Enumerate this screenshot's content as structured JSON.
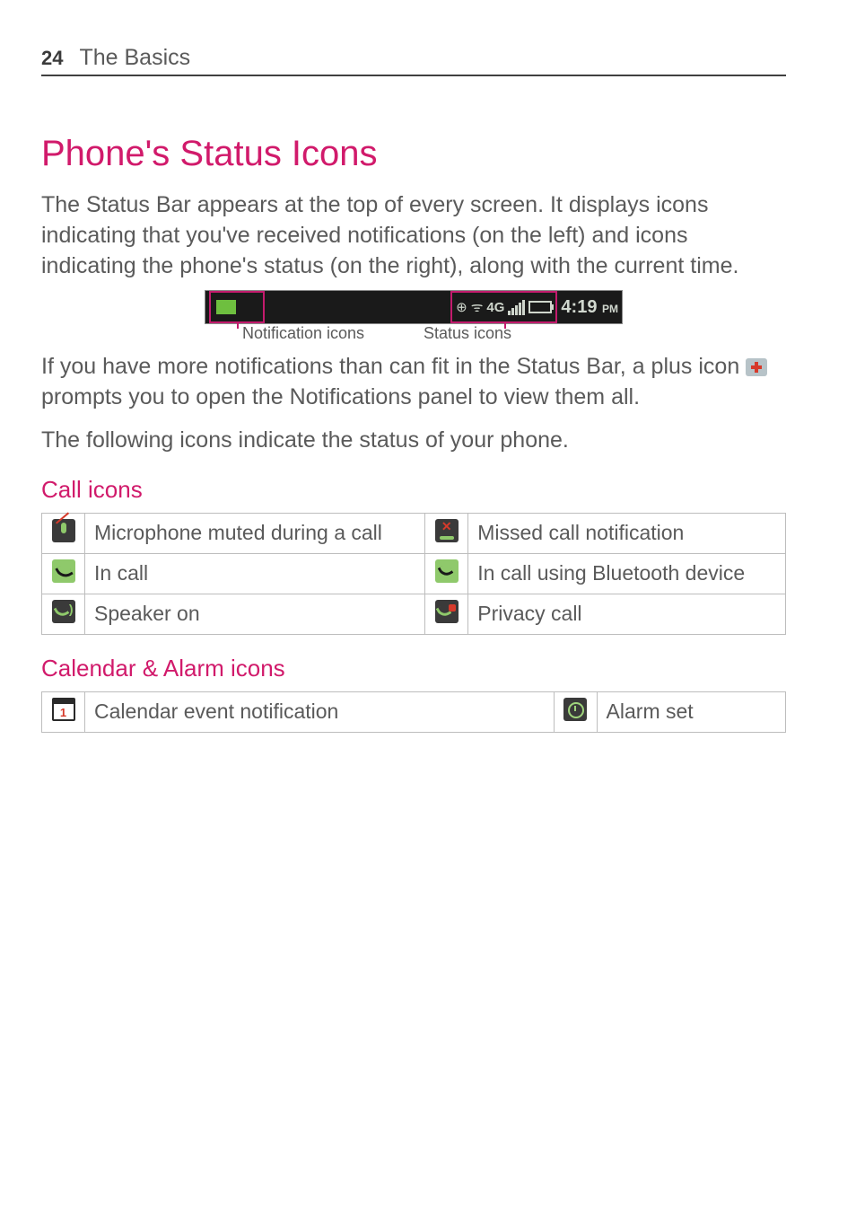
{
  "header": {
    "page_number": "24",
    "section": "The Basics"
  },
  "title": "Phone's Status Icons",
  "intro": "The Status Bar appears at the top of every screen. It displays icons indicating that you've received notifications (on the left) and icons indicating the phone's status (on the right), along with the current time.",
  "status_bar": {
    "time": "4:19",
    "time_suffix": "PM",
    "data_label": "4G",
    "caption_left": "Notification icons",
    "caption_right": "Status icons"
  },
  "plus_para_a": "If you have more notifications than can fit in the Status Bar, a plus icon ",
  "plus_para_b": " prompts you to open the Notifications panel to view them all.",
  "following": "The following icons indicate the status of your phone.",
  "sections": {
    "call": {
      "heading": "Call icons",
      "rows": [
        {
          "left": "Microphone muted during a call",
          "right": "Missed call notification"
        },
        {
          "left": "In call",
          "right": "In call using Bluetooth device"
        },
        {
          "left": "Speaker on",
          "right": "Privacy call"
        }
      ]
    },
    "calendar": {
      "heading": "Calendar & Alarm icons",
      "rows": [
        {
          "left": "Calendar event notification",
          "right": "Alarm set"
        }
      ]
    }
  }
}
